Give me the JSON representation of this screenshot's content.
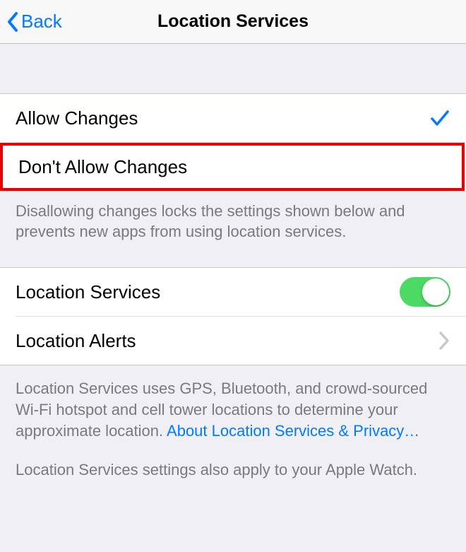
{
  "navbar": {
    "back_label": "Back",
    "title": "Location Services"
  },
  "changes_group": {
    "allow_label": "Allow Changes",
    "dont_allow_label": "Don't Allow Changes",
    "footer": "Disallowing changes locks the settings shown below and prevents new apps from using location services."
  },
  "services_group": {
    "location_services_label": "Location Services",
    "location_alerts_label": "Location Alerts"
  },
  "footer2": {
    "para1_prefix": "Location Services uses GPS, Bluetooth, and crowd-sourced Wi-Fi hotspot and cell tower locations to determine your approximate location. ",
    "link": "About Location Services & Privacy…",
    "para2": "Location Services settings also apply to your Apple Watch."
  }
}
